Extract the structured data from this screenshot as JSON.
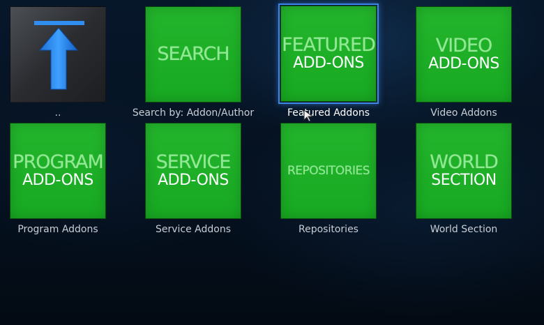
{
  "tiles": [
    {
      "label": "..",
      "art_thin": "",
      "art_bold": ""
    },
    {
      "label": "Search by: Addon/Author",
      "art_thin": "SEARCH",
      "art_bold": ""
    },
    {
      "label": "Featured Addons",
      "art_thin": "FEATURED",
      "art_bold": "ADD-ONS"
    },
    {
      "label": "Video Addons",
      "art_thin": "VIDEO",
      "art_bold": "ADD-ONS"
    },
    {
      "label": "Program Addons",
      "art_thin": "PROGRAM",
      "art_bold": "ADD-ONS"
    },
    {
      "label": "Service Addons",
      "art_thin": "SERVICE",
      "art_bold": "ADD-ONS"
    },
    {
      "label": "Repositories",
      "art_thin": "REPOSITORIES",
      "art_bold": ""
    },
    {
      "label": "World Section",
      "art_thin": "WORLD",
      "art_bold": "SECTION"
    }
  ],
  "icons": {
    "parent": "up-arrow-icon",
    "cursor": "mouse-pointer-icon"
  },
  "colors": {
    "tile_green": "#23b52c",
    "focus_border": "#3d86e6",
    "arrow_blue": "#2b8ff0"
  },
  "focused_index": 2
}
